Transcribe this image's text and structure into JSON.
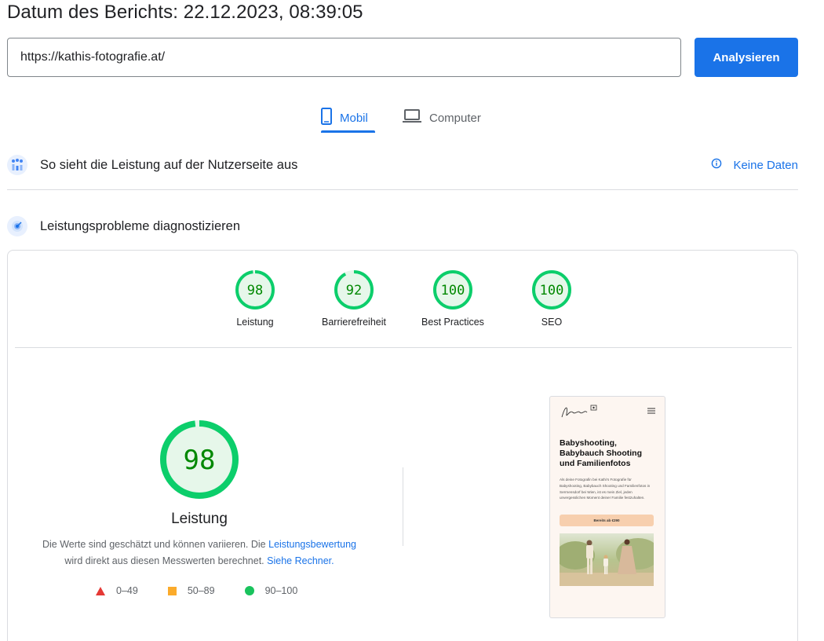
{
  "header": {
    "report_date": "Datum des Berichts: 22.12.2023, 08:39:05"
  },
  "search": {
    "url": "https://kathis-fotografie.at/",
    "button_label": "Analysieren"
  },
  "tabs": [
    {
      "label": "Mobil",
      "icon": "smartphone-icon",
      "selected": true
    },
    {
      "label": "Computer",
      "icon": "laptop-icon",
      "selected": false
    }
  ],
  "field_data": {
    "title": "So sieht die Leistung auf der Nutzerseite aus",
    "status": "Keine Daten"
  },
  "lab_data": {
    "title": "Leistungsprobleme diagnostizieren"
  },
  "scores": [
    {
      "label": "Leistung",
      "value": 98
    },
    {
      "label": "Barrierefreiheit",
      "value": 92
    },
    {
      "label": "Best Practices",
      "value": 100
    },
    {
      "label": "SEO",
      "value": 100
    }
  ],
  "performance": {
    "score": 98,
    "label": "Leistung",
    "note_part1": "Die Werte sind geschätzt und können variieren. Die",
    "note_link1": "Leistungsbewertung",
    "note_part2": "wird direkt aus diesen Messwerten berechnet.",
    "note_link2": "Siehe Rechner."
  },
  "legend": [
    {
      "range": "0–49",
      "symbol": "triangle",
      "color": "#e53935"
    },
    {
      "range": "50–89",
      "symbol": "square",
      "color": "#fbab2b"
    },
    {
      "range": "90–100",
      "symbol": "circle",
      "color": "#19c35d"
    }
  ],
  "screenshot": {
    "headline": "Babyshooting, Babybauch Shooting und Familienfotos",
    "paragraph": "Als deine Fotografin bei Kathi's Fotografie für Babyshooting, Babybauch Shooting und Familienfotos in Serrnensdorf bei Wien, ist es mein Ziel, jeden unvergesslichen Moment deiner Familie festzuhalten.",
    "cta": "Bereits ab €290"
  },
  "colors": {
    "accent": "#1a73e8",
    "good": "#0cce6b",
    "good_text": "#008800",
    "good_fill": "#e6f7ea"
  }
}
